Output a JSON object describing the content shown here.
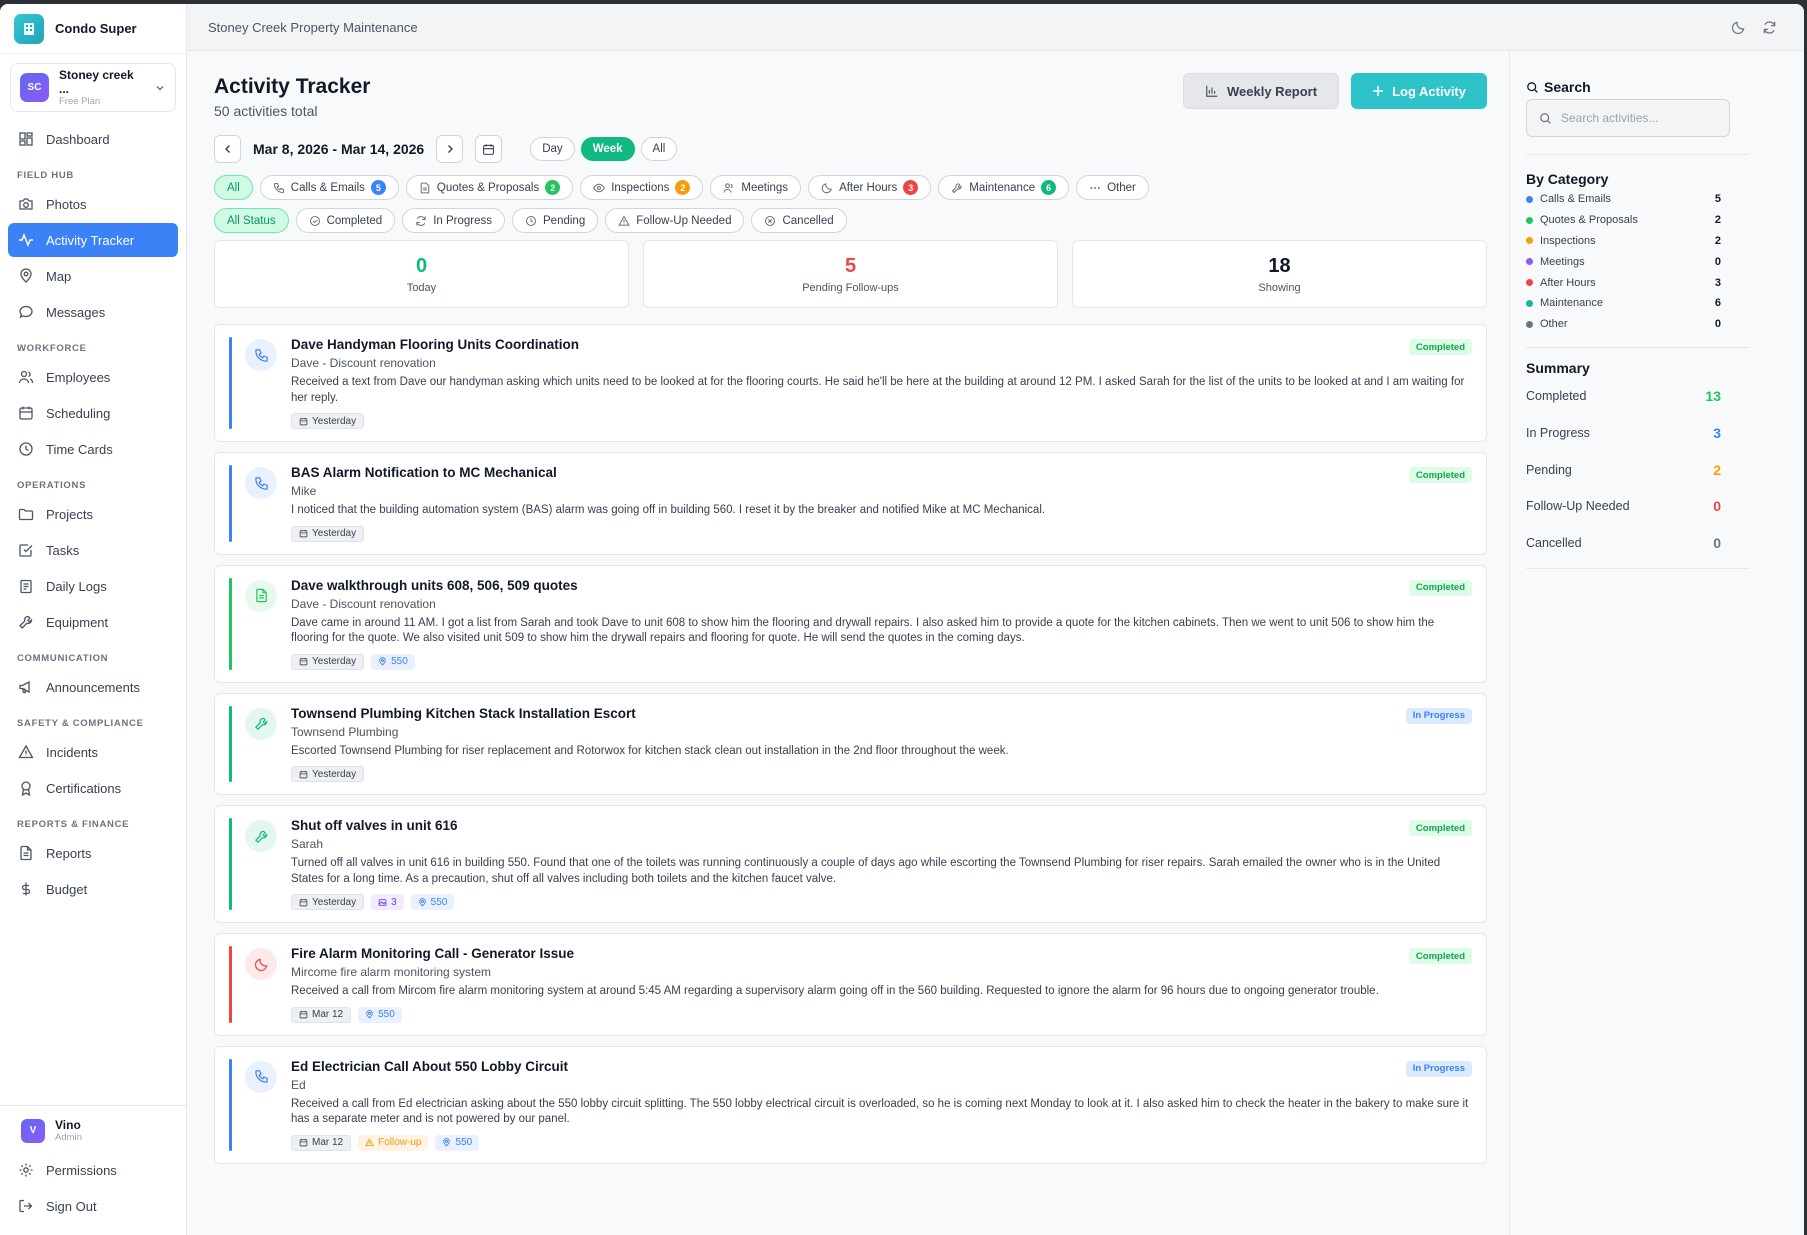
{
  "app": {
    "name": "Condo Super"
  },
  "org": {
    "initials": "SC",
    "name": "Stoney creek ...",
    "plan": "Free Plan"
  },
  "nav": {
    "dashboard": "Dashboard",
    "field_hub": "FIELD HUB",
    "photos": "Photos",
    "activity_tracker": "Activity Tracker",
    "map": "Map",
    "messages": "Messages",
    "workforce": "WORKFORCE",
    "employees": "Employees",
    "scheduling": "Scheduling",
    "time_cards": "Time Cards",
    "operations": "OPERATIONS",
    "projects": "Projects",
    "tasks": "Tasks",
    "daily_logs": "Daily Logs",
    "equipment": "Equipment",
    "communication": "COMMUNICATION",
    "announcements": "Announcements",
    "safety": "SAFETY & COMPLIANCE",
    "incidents": "Incidents",
    "certifications": "Certifications",
    "reports_finance": "REPORTS & FINANCE",
    "reports": "Reports",
    "budget": "Budget"
  },
  "user": {
    "initial": "V",
    "name": "Vino",
    "role": "Admin",
    "permissions": "Permissions",
    "sign_out": "Sign Out"
  },
  "topbar": {
    "title": "Stoney Creek Property Maintenance"
  },
  "header": {
    "title": "Activity Tracker",
    "subtitle": "50 activities total",
    "weekly_report": "Weekly Report",
    "log_activity": "Log Activity"
  },
  "date": {
    "range": "Mar 8, 2026 - Mar 14, 2026",
    "views": [
      "Day",
      "Week",
      "All"
    ],
    "selected_view": "Week"
  },
  "categories": [
    {
      "label": "All",
      "count": "",
      "color": ""
    },
    {
      "label": "Calls & Emails",
      "count": "5",
      "color": "#3b82f6"
    },
    {
      "label": "Quotes & Proposals",
      "count": "2",
      "color": "#22c55e"
    },
    {
      "label": "Inspections",
      "count": "2",
      "color": "#f59e0b"
    },
    {
      "label": "Meetings",
      "count": "",
      "color": ""
    },
    {
      "label": "After Hours",
      "count": "3",
      "color": "#ef4444"
    },
    {
      "label": "Maintenance",
      "count": "6",
      "color": "#10b981"
    },
    {
      "label": "Other",
      "count": "",
      "color": ""
    }
  ],
  "statuses": [
    "All Status",
    "Completed",
    "In Progress",
    "Pending",
    "Follow-Up Needed",
    "Cancelled"
  ],
  "stats": [
    {
      "value": "0",
      "label": "Today",
      "color": "#10b981"
    },
    {
      "value": "5",
      "label": "Pending Follow-ups",
      "color": "#ef4444"
    },
    {
      "value": "18",
      "label": "Showing",
      "color": "#111827"
    }
  ],
  "activities": [
    {
      "title": "Dave Handyman Flooring Units Coordination",
      "who": "Dave - Discount renovation",
      "desc": "Received a text from Dave our handyman asking which units need to be looked at for the flooring courts. He said he'll be here at the building at around 12 PM. I asked Sarah for the list of the units to be looked at and I am waiting for her reply.",
      "status": "Completed",
      "date": "Yesterday",
      "photos": "",
      "followup": "",
      "location": "",
      "icon": "phone-icon",
      "accent": "#3b82f6"
    },
    {
      "title": "BAS Alarm Notification to MC Mechanical",
      "who": "Mike",
      "desc": "I noticed that the building automation system (BAS) alarm was going off in building 560. I reset it by the breaker and notified Mike at MC Mechanical.",
      "status": "Completed",
      "date": "Yesterday",
      "photos": "",
      "followup": "",
      "location": "",
      "icon": "phone-icon",
      "accent": "#3b82f6"
    },
    {
      "title": "Dave walkthrough units 608, 506, 509 quotes",
      "who": "Dave - Discount renovation",
      "desc": "Dave came in around 11 AM. I got a list from Sarah and took Dave to unit 608 to show him the flooring and drywall repairs. I also asked him to provide a quote for the kitchen cabinets. Then we went to unit 506 to show him the flooring for the quote. We also visited unit 509 to show him the drywall repairs and flooring for quote. He will send the quotes in the coming days.",
      "status": "Completed",
      "date": "Yesterday",
      "photos": "",
      "followup": "",
      "location": "550",
      "icon": "document-icon",
      "accent": "#22c55e"
    },
    {
      "title": "Townsend Plumbing Kitchen Stack Installation Escort",
      "who": "Townsend Plumbing",
      "desc": "Escorted Townsend Plumbing for riser replacement and Rotorwox for kitchen stack clean out installation in the 2nd floor throughout the week.",
      "status": "In Progress",
      "date": "Yesterday",
      "photos": "",
      "followup": "",
      "location": "",
      "icon": "wrench-icon",
      "accent": "#10b981"
    },
    {
      "title": "Shut off valves in unit 616",
      "who": "Sarah",
      "desc": "Turned off all valves in unit 616 in building 550. Found that one of the toilets was running continuously a couple of days ago while escorting the Townsend Plumbing for riser repairs. Sarah emailed the owner who is in the United States for a long time. As a precaution, shut off all valves including both toilets and the kitchen faucet valve.",
      "status": "Completed",
      "date": "Yesterday",
      "photos": "3",
      "followup": "",
      "location": "550",
      "icon": "wrench-icon",
      "accent": "#10b981"
    },
    {
      "title": "Fire Alarm Monitoring Call - Generator Issue",
      "who": "Mircome fire alarm monitoring system",
      "desc": "Received a call from Mircom fire alarm monitoring system at around 5:45 AM regarding a supervisory alarm going off in the 560 building. Requested to ignore the alarm for 96 hours due to ongoing generator trouble.",
      "status": "Completed",
      "date": "Mar 12",
      "photos": "",
      "followup": "",
      "location": "550",
      "icon": "moon-icon",
      "accent": "#ef4444"
    },
    {
      "title": "Ed Electrician Call About 550 Lobby Circuit",
      "who": "Ed",
      "desc": "Received a call from Ed electrician asking about the 550 lobby circuit splitting. The 550 lobby electrical circuit is overloaded, so he is coming next Monday to look at it. I also asked him to check the heater in the bakery to make sure it has a separate meter and is not powered by our panel.",
      "status": "In Progress",
      "date": "Mar 12",
      "photos": "",
      "followup": "Follow-up",
      "location": "550",
      "icon": "phone-icon",
      "accent": "#3b82f6"
    }
  ],
  "search": {
    "title": "Search",
    "placeholder": "Search activities..."
  },
  "by_category": {
    "title": "By Category",
    "items": [
      {
        "label": "Calls & Emails",
        "count": "5",
        "color": "#3b82f6"
      },
      {
        "label": "Quotes & Proposals",
        "count": "2",
        "color": "#22c55e"
      },
      {
        "label": "Inspections",
        "count": "2",
        "color": "#f59e0b"
      },
      {
        "label": "Meetings",
        "count": "0",
        "color": "#8b5cf6"
      },
      {
        "label": "After Hours",
        "count": "3",
        "color": "#ef4444"
      },
      {
        "label": "Maintenance",
        "count": "6",
        "color": "#14b8a6"
      },
      {
        "label": "Other",
        "count": "0",
        "color": "#6b7280"
      }
    ]
  },
  "summary": {
    "title": "Summary",
    "items": [
      {
        "label": "Completed",
        "count": "13",
        "color": "#22c55e"
      },
      {
        "label": "In Progress",
        "count": "3",
        "color": "#3b82f6"
      },
      {
        "label": "Pending",
        "count": "2",
        "color": "#f59e0b"
      },
      {
        "label": "Follow-Up Needed",
        "count": "0",
        "color": "#ef4444"
      },
      {
        "label": "Cancelled",
        "count": "0",
        "color": "#6b7280"
      }
    ]
  }
}
